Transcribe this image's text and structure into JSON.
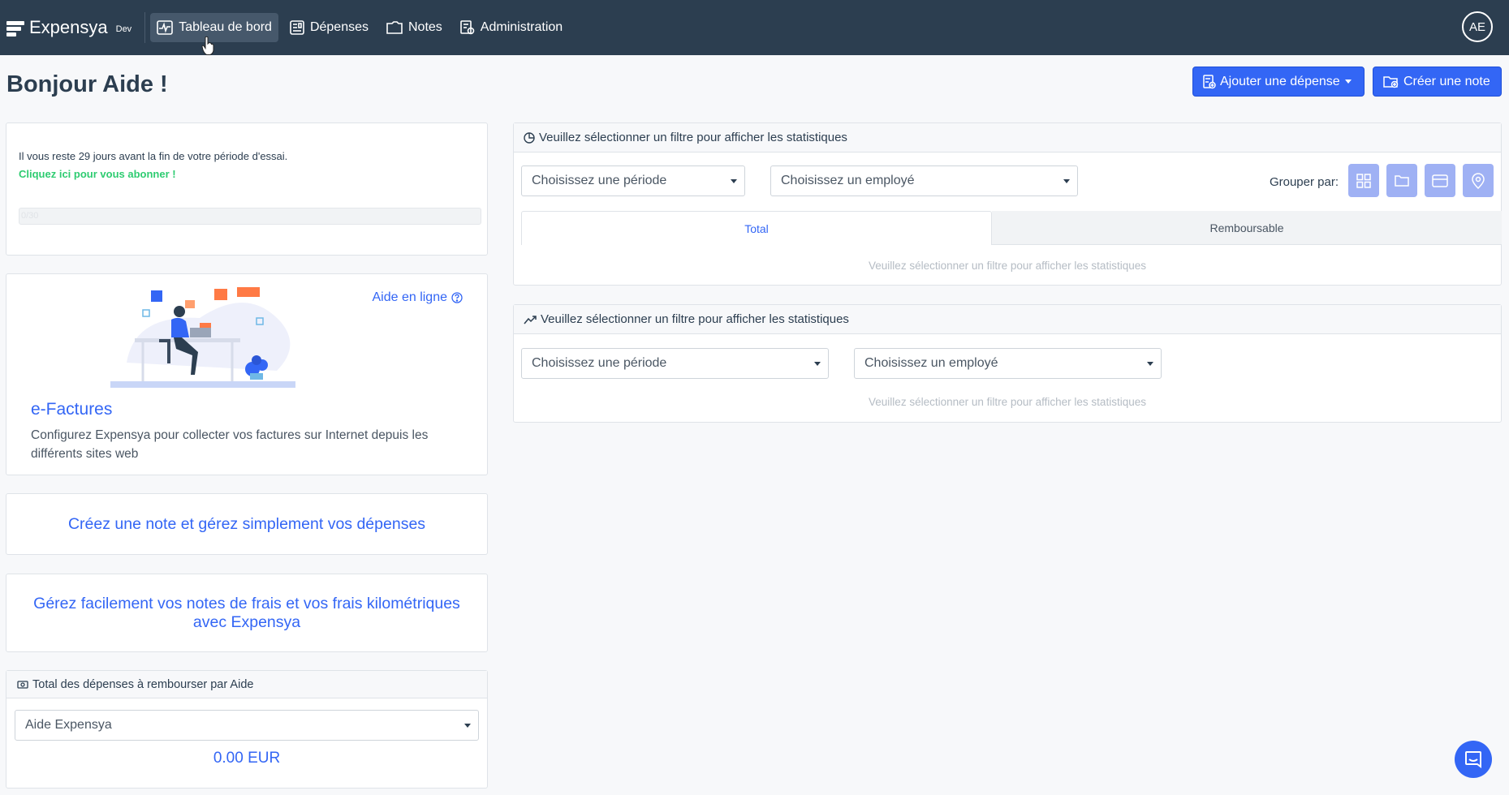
{
  "app": {
    "name": "Expensya",
    "env": "Dev"
  },
  "nav": {
    "items": [
      {
        "label": "Tableau de bord",
        "icon": "dashboard-icon"
      },
      {
        "label": "Dépenses",
        "icon": "receipt-icon"
      },
      {
        "label": "Notes",
        "icon": "folder-icon"
      },
      {
        "label": "Administration",
        "icon": "admin-icon"
      }
    ],
    "avatar": "AE"
  },
  "header": {
    "title": "Bonjour Aide !",
    "add_expense": "Ajouter une dépense",
    "create_note": "Créer une note"
  },
  "trial": {
    "text": "Il vous reste 29 jours avant la fin de votre période d'essai.",
    "link": "Cliquez ici pour vous abonner !",
    "progress_label": "0/30",
    "progress_value": 0
  },
  "efactures": {
    "help": "Aide en ligne",
    "title": "e-Factures",
    "description": "Configurez Expensya pour collecter vos factures sur Internet depuis les différents sites web"
  },
  "promos": {
    "note": "Créez une note et gérez simplement vos dépenses",
    "frais": "Gérez facilement vos notes de frais et vos frais kilométriques avec Expensya"
  },
  "reimburse": {
    "title": "Total des dépenses à rembourser par Aide",
    "select": "Aide Expensya",
    "amount": "0.00 EUR"
  },
  "stats1": {
    "title": "Veuillez sélectionner un filtre pour afficher les statistiques",
    "period_placeholder": "Choisissez une période",
    "employee_placeholder": "Choisissez un employé",
    "group_label": "Grouper par:",
    "tabs": [
      "Total",
      "Remboursable"
    ],
    "empty": "Veuillez sélectionner un filtre pour afficher les statistiques"
  },
  "stats2": {
    "title": "Veuillez sélectionner un filtre pour afficher les statistiques",
    "period_placeholder": "Choisissez une période",
    "employee_placeholder": "Choisissez un employé",
    "empty": "Veuillez sélectionner un filtre pour afficher les statistiques"
  },
  "colors": {
    "navbar": "#2c3e50",
    "primary": "#3366f5",
    "success": "#2ecc71",
    "group_btn": "#9fb1f4"
  }
}
